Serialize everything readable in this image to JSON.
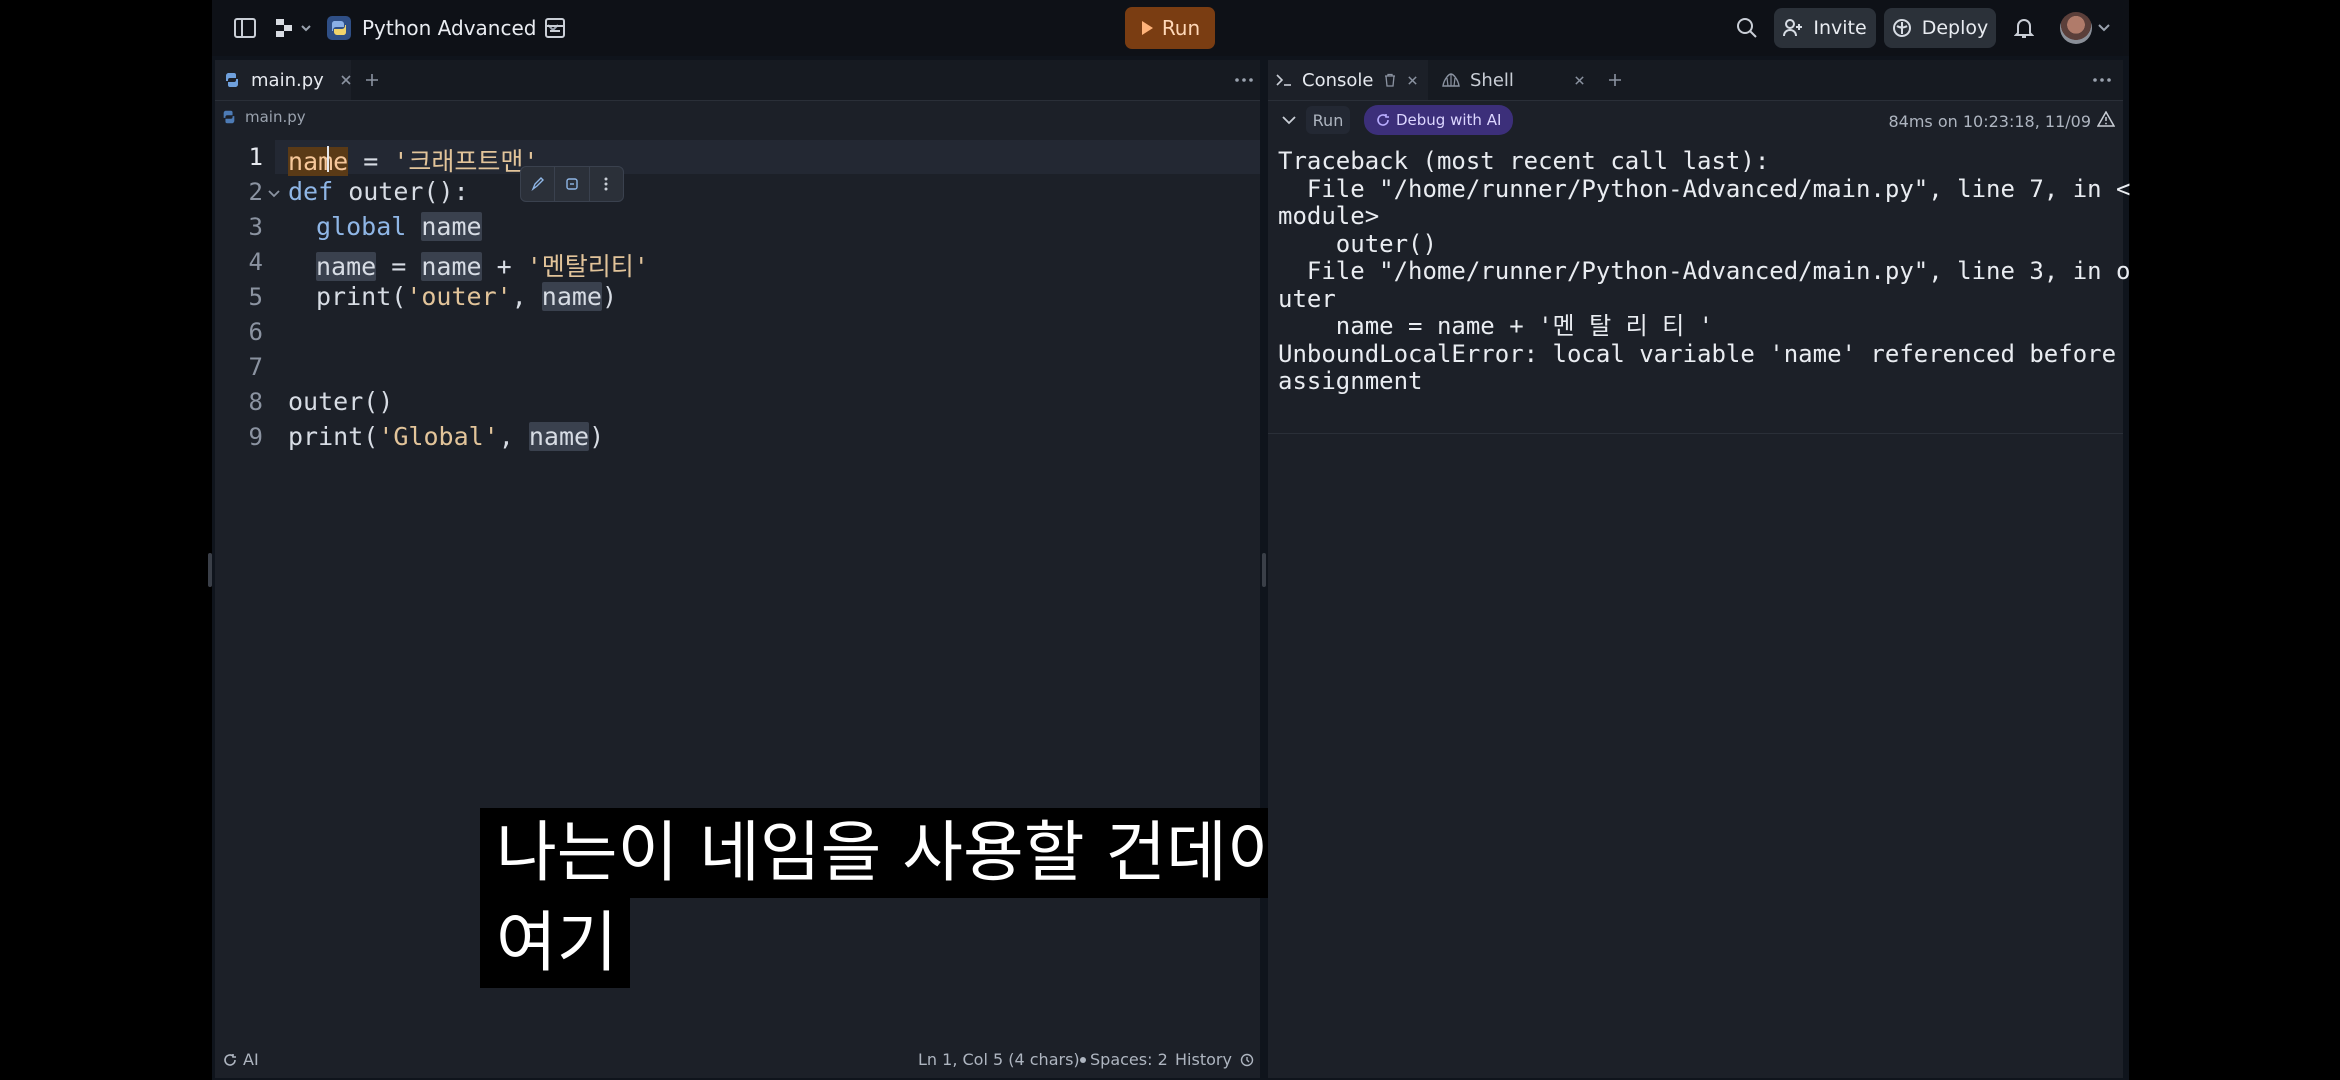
{
  "topbar": {
    "project_name": "Python Advanced",
    "run_label": "Run",
    "invite_label": "Invite",
    "deploy_label": "Deploy"
  },
  "editor": {
    "tab_label": "main.py",
    "breadcrumb": "main.py",
    "lines": [
      {
        "num": "1",
        "parts": [
          "name",
          " = ",
          "'크래프트맨'"
        ]
      },
      {
        "num": "2",
        "parts": [
          "def",
          " outer():"
        ]
      },
      {
        "num": "3",
        "parts": [
          "global",
          " ",
          "name"
        ]
      },
      {
        "num": "4",
        "parts": [
          "name",
          " = ",
          "name",
          " + ",
          "'멘탈리티'"
        ]
      },
      {
        "num": "5",
        "parts": [
          "print(",
          "'outer'",
          ", ",
          "name",
          ")"
        ]
      },
      {
        "num": "6",
        "parts": []
      },
      {
        "num": "7",
        "parts": []
      },
      {
        "num": "8",
        "parts": [
          "outer()"
        ]
      },
      {
        "num": "9",
        "parts": [
          "print(",
          "'Global'",
          ", ",
          "name",
          ")"
        ]
      }
    ],
    "subtitle_line1": "나는이 네임을 사용할 건데이 네임은",
    "subtitle_line2": "여기",
    "status": {
      "ai_label": "AI",
      "cursor_pos": "Ln 1, Col 5 (4 chars)",
      "spaces": "Spaces: 2",
      "history": "History"
    }
  },
  "console": {
    "tab_console": "Console",
    "tab_shell": "Shell",
    "run_label": "Run",
    "debug_label": "Debug with AI",
    "timing": "84ms on 10:23:18, 11/09",
    "output": [
      "Traceback (most recent call last):",
      "  File \"/home/runner/Python-Advanced/main.py\", line 7, in <",
      "module>",
      "    outer()",
      "  File \"/home/runner/Python-Advanced/main.py\", line 3, in o",
      "uter",
      "    name = name + '멘 탈 리 티 '",
      "UnboundLocalError: local variable 'name' referenced before",
      "assignment"
    ]
  }
}
